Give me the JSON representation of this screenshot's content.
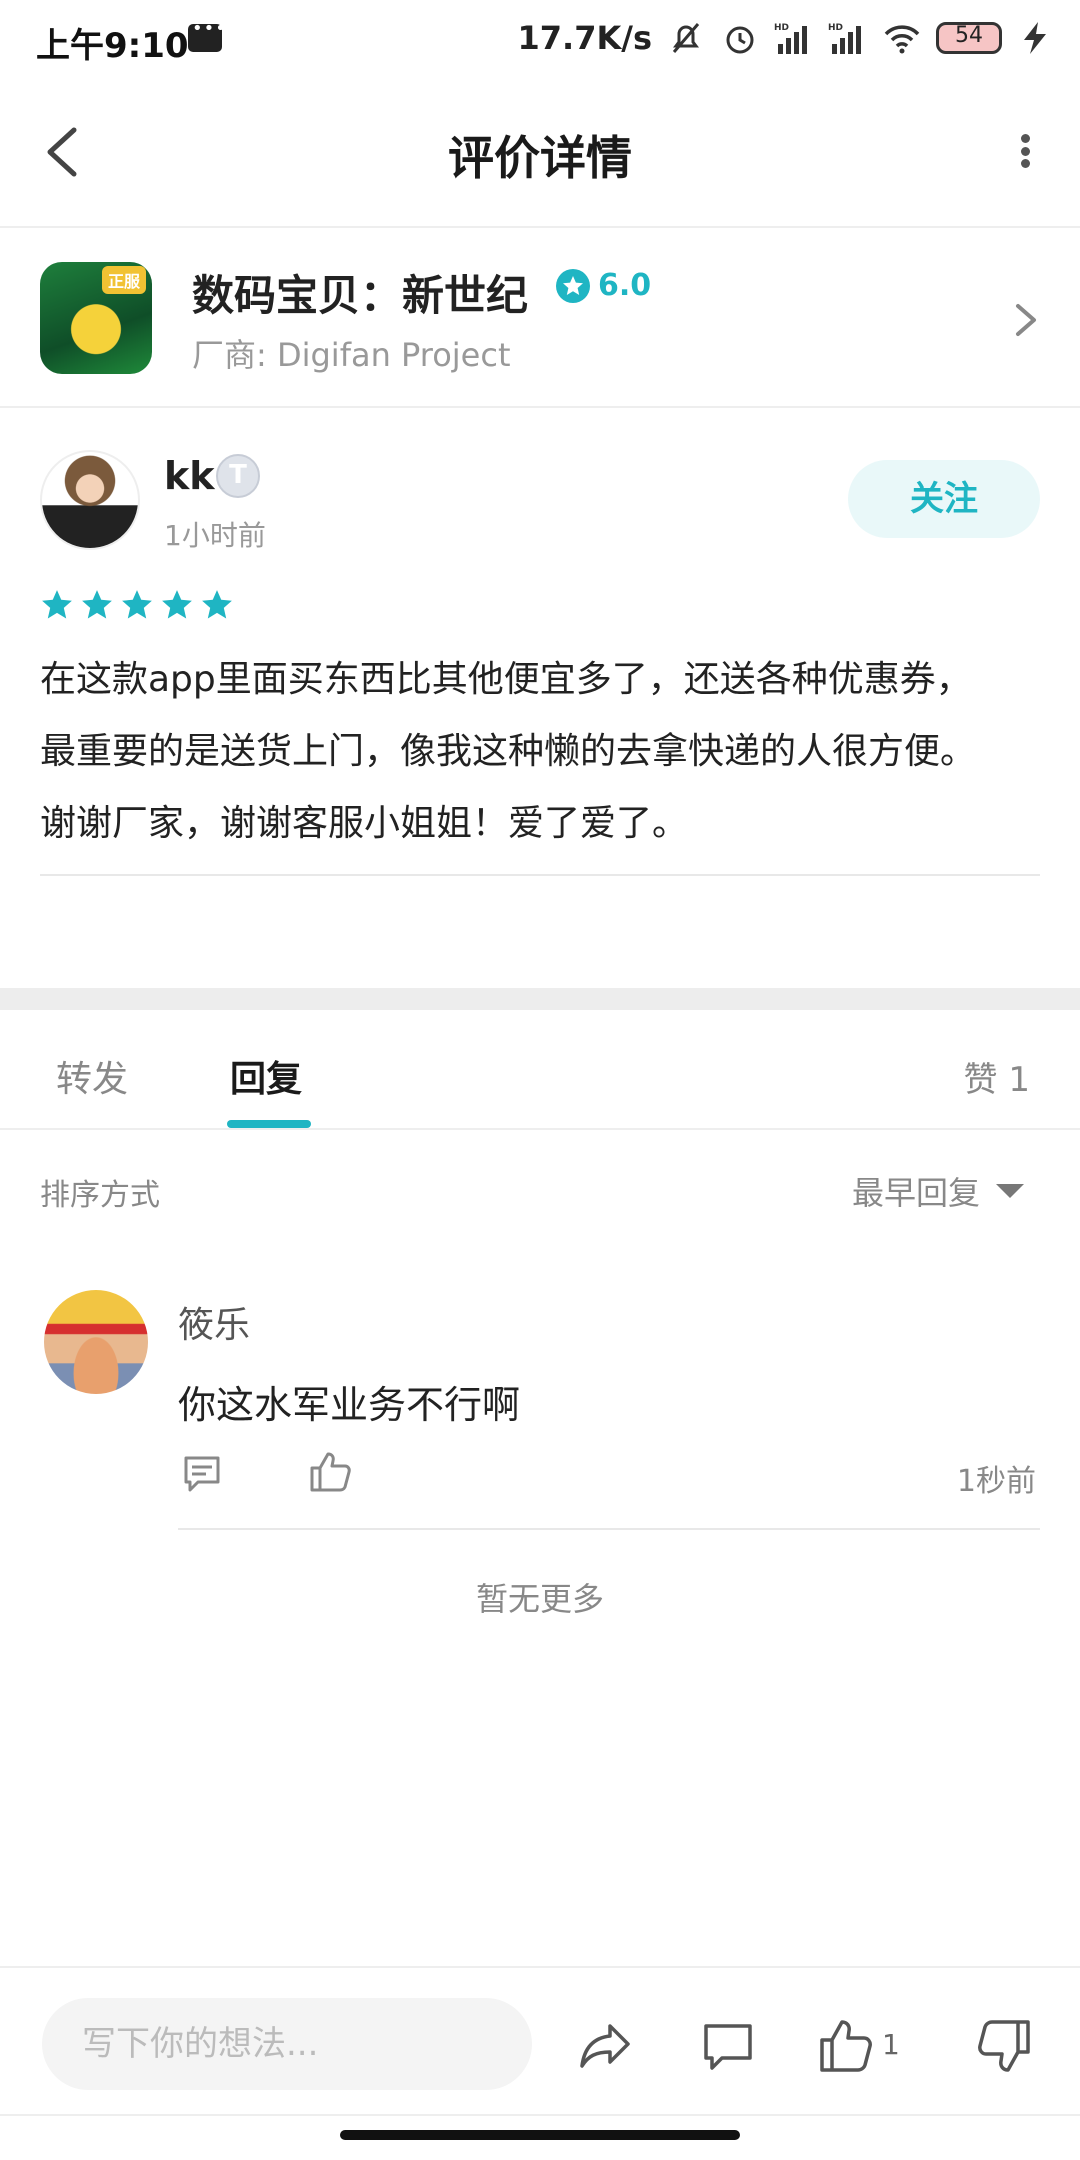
{
  "status_bar": {
    "time": "上午9:10",
    "net_speed": "17.7K/s",
    "battery": "54"
  },
  "header": {
    "title": "评价详情"
  },
  "game": {
    "name": "数码宝贝：新世纪",
    "icon_badge": "正服",
    "rating": "6.0",
    "developer": "厂商: Digifan Project"
  },
  "review": {
    "user_name": "kk",
    "user_level": "T",
    "time": "1小时前",
    "follow_label": "关注",
    "stars": 5,
    "text_lines": [
      "在这款app里面买东西比其他便宜多了，还送各种优惠券，",
      "最重要的是送货上门，像我这种懒的去拿快递的人很方便。",
      "谢谢厂家，谢谢客服小姐姐！爱了爱了。"
    ]
  },
  "tabs": {
    "forward": "转发",
    "reply": "回复",
    "likes": "赞 1"
  },
  "sort": {
    "label": "排序方式",
    "selected": "最早回复"
  },
  "replies": [
    {
      "name": "筱乐",
      "text": "你这水军业务不行啊",
      "time": "1秒前"
    }
  ],
  "no_more": "暂无更多",
  "bottom_bar": {
    "input_placeholder": "写下你的想法...",
    "like_count": "1"
  },
  "colors": {
    "accent": "#1fb5c3"
  }
}
